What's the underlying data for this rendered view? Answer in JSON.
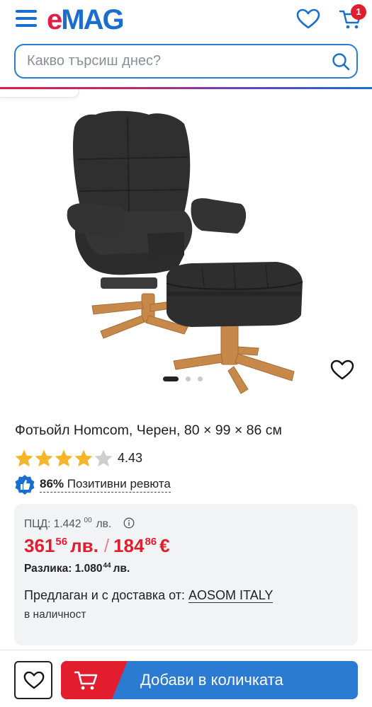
{
  "header": {
    "logo": {
      "first": "e",
      "rest": "MAG"
    },
    "cart_count": "1"
  },
  "search": {
    "placeholder": "Какво търсиш днес?"
  },
  "gallery": {
    "total_images": 3,
    "active_index": 0
  },
  "product": {
    "title": "Фотьойл Homcom, Черен, 80 × 99 × 86 см",
    "rating": "4.43",
    "rating_value": 4.43,
    "rating_max": 5,
    "positive_percent": "86%",
    "positive_label": "Позитивни ревюта"
  },
  "pricing": {
    "rrp_label": "ПЦД: 1.442",
    "rrp_decimals": "00",
    "rrp_currency": "лв.",
    "price_bgn_main": "361",
    "price_bgn_decimals": "56",
    "price_bgn_currency": "лв.",
    "separator": "/",
    "price_eur_main": "184",
    "price_eur_decimals": "86",
    "price_eur_currency": "€",
    "difference_label": "Разлика: 1.080",
    "difference_decimals": "44",
    "difference_currency": "лв.",
    "seller_prefix": "Предлаган и с доставка от:",
    "seller_name": "AOSOM ITALY",
    "stock_status": "в наличност"
  },
  "actions": {
    "add_to_cart_label": "Добави в количката"
  },
  "colors": {
    "brand_red": "#e11d2e",
    "brand_blue": "#2a7bd1",
    "star_yellow": "#f5b52b"
  }
}
